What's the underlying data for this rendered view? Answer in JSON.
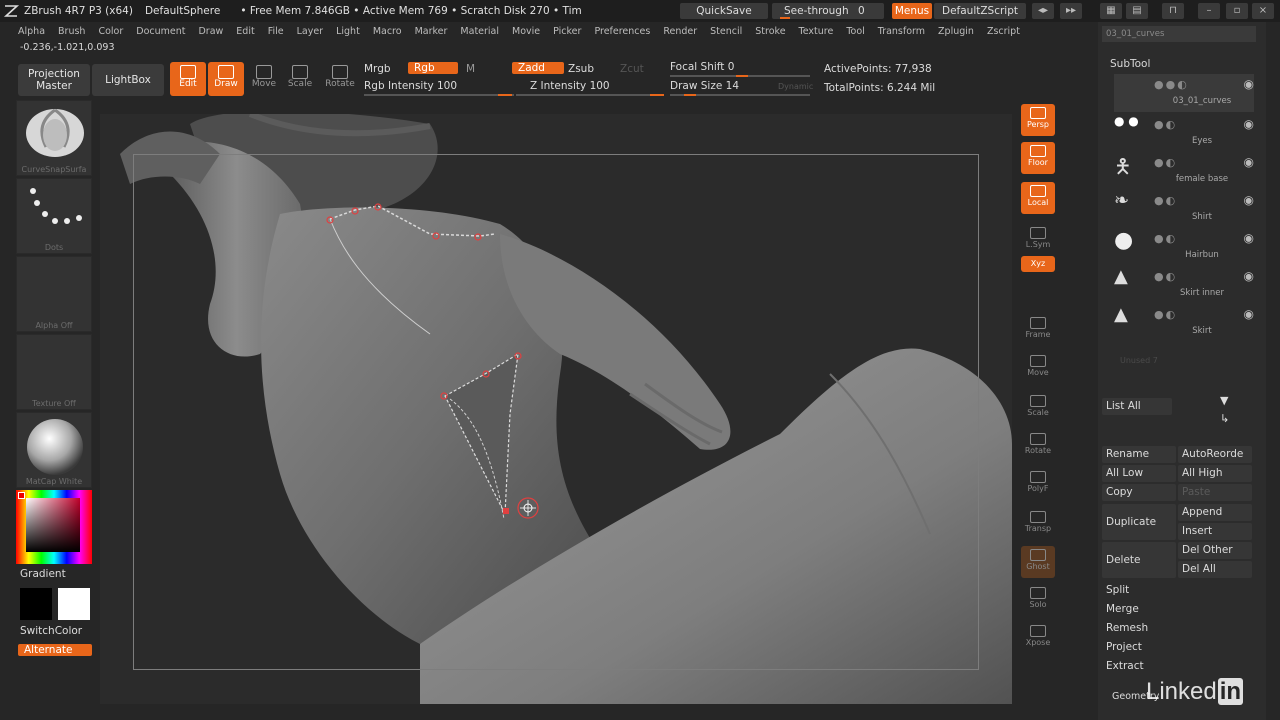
{
  "title": {
    "app": "ZBrush 4R7 P3 (x64)",
    "project": "DefaultSphere",
    "status": "• Free Mem 7.846GB • Active Mem 769 • Scratch Disk 270 • Tim",
    "quicksave": "QuickSave",
    "see_through": "See-through",
    "see_through_value": "0",
    "menus": "Menus",
    "script": "DefaultZScript"
  },
  "menubar": [
    "Alpha",
    "Brush",
    "Color",
    "Document",
    "Draw",
    "Edit",
    "File",
    "Layer",
    "Light",
    "Macro",
    "Marker",
    "Material",
    "Movie",
    "Picker",
    "Preferences",
    "Render",
    "Stencil",
    "Stroke",
    "Texture",
    "Tool",
    "Transform",
    "Zplugin",
    "Zscript"
  ],
  "coords": "-0.236,-1.021,0.093",
  "toolbar": {
    "projection_master": "Projection Master",
    "lightbox": "LightBox",
    "edit": "Edit",
    "draw": "Draw",
    "move": "Move",
    "scale": "Scale",
    "rotate": "Rotate",
    "mrgb": "Mrgb",
    "rgb": "Rgb",
    "m": "M",
    "rgb_intensity": "Rgb Intensity 100",
    "zadd": "Zadd",
    "zsub": "Zsub",
    "zcut": "Zcut",
    "z_intensity": "Z Intensity 100",
    "focal_shift": "Focal Shift 0",
    "draw_size": "Draw Size 14",
    "dynamic": "Dynamic",
    "active_points": "ActivePoints: 77,938",
    "total_points": "TotalPoints: 6.244 Mil"
  },
  "leftshelf": {
    "brush": "CurveSnapSurfa",
    "stroke": "Dots",
    "alpha": "Alpha Off",
    "texture": "Texture Off",
    "material": "MatCap White",
    "gradient": "Gradient",
    "switchcolor": "SwitchColor",
    "alternate": "Alternate"
  },
  "rightshelf": [
    "Persp",
    "Floor",
    "Local",
    "L.Sym",
    "Xyz",
    "Frame",
    "Move",
    "Scale",
    "Rotate",
    "PolyF",
    "Transp",
    "Ghost",
    "Solo",
    "Xpose"
  ],
  "rpanel": {
    "current_tool": "03_01_curves",
    "subtool_title": "SubTool",
    "subtools": [
      {
        "name": "03_01_curves"
      },
      {
        "name": "Eyes"
      },
      {
        "name": "female base"
      },
      {
        "name": "Shirt"
      },
      {
        "name": "Hairbun"
      },
      {
        "name": "Skirt inner"
      },
      {
        "name": "Skirt"
      }
    ],
    "unused": "Unused 7",
    "list_all": "List All",
    "rename": "Rename",
    "autoreorder": "AutoReorde",
    "all_low": "All Low",
    "all_high": "All High",
    "copy": "Copy",
    "paste": "Paste",
    "duplicate": "Duplicate",
    "append": "Append",
    "insert": "Insert",
    "delete": "Delete",
    "del_other": "Del Other",
    "del_all": "Del All",
    "split": "Split",
    "merge": "Merge",
    "remesh": "Remesh",
    "project": "Project",
    "extract": "Extract",
    "geometry": "Geometry"
  },
  "brand": {
    "text": "Linked",
    "suffix": "in"
  },
  "colors": {
    "accent": "#e8661a",
    "panel": "#2c2c2c",
    "background": "#262626"
  }
}
